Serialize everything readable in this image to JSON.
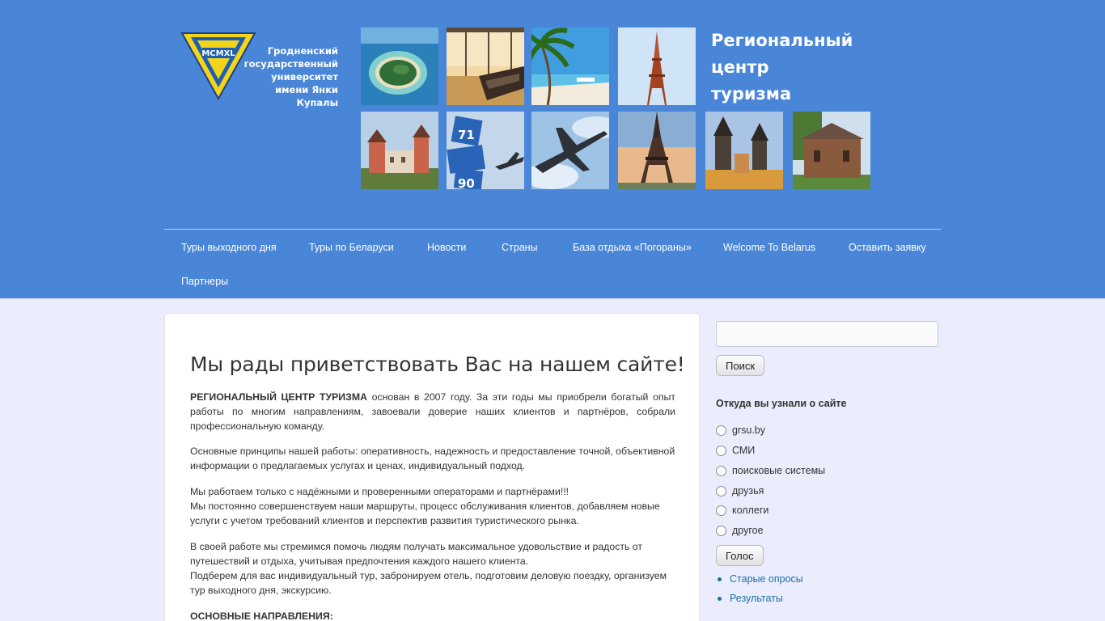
{
  "header": {
    "logo_emblem": "MCMXL",
    "university_lines": [
      "Гродненский",
      "государственный",
      "университет",
      "имени Янки Купалы"
    ],
    "region_title_lines": [
      "Региональный",
      "центр",
      "туризма"
    ]
  },
  "nav": {
    "items": [
      "Туры выходного дня",
      "Туры по Беларуси",
      "Новости",
      "Страны",
      "База отдыха «Погораны»",
      "Welcome To Belarus",
      "Оставить заявку",
      "Партнеры"
    ]
  },
  "content": {
    "heading": "Мы рады приветствовать Вас на нашем сайте!",
    "p1_bold": "РЕГИОНАЛЬНЫЙ ЦЕНТР ТУРИЗМА",
    "p1_rest": " основан в 2007 году. За эти годы мы приобрели богатый опыт работы по многим направлениям, завоевали доверие наших клиентов и партнёров, собрали профессиональную команду.",
    "p2": "Основные принципы нашей работы: оперативность, надежность и предоставление точной, объективной информации о предлагаемых услугах и ценах, индивидуальный подход.",
    "p3a": "Мы работаем только с надёжными и проверенными операторами и партнёрами!!!",
    "p3b": "Мы постоянно совершенствуем наши маршруты, процесс обслуживания клиентов, добавляем новые услуги с учетом требований клиентов и перспектив развития туристического рынка.",
    "p4a": "В своей работе мы стремимся помочь людям получать максимальное удовольствие и радость от путешествий и отдыха, учитывая предпочтения каждого нашего клиента.",
    "p4b": "Подберем для вас индивидуальный тур, забронируем отель, подготовим деловую поездку, организуем тур выходного дня, экскурсию.",
    "p5": "ОСНОВНЫЕ НАПРАВЛЕНИЯ:"
  },
  "sidebar": {
    "search_value": "",
    "search_button": "Поиск",
    "poll_title": "Откуда вы узнали о сайте",
    "poll_options": [
      "grsu.by",
      "СМИ",
      "поисковые системы",
      "друзья",
      "коллеги",
      "другое"
    ],
    "vote_button": "Голос",
    "links": [
      "Старые опросы",
      "Результаты"
    ]
  },
  "colors": {
    "header_bg": "#4a86d8",
    "page_bg": "#ebedfd",
    "link": "#1a6fa8",
    "logo_yellow": "#f2d41a"
  }
}
